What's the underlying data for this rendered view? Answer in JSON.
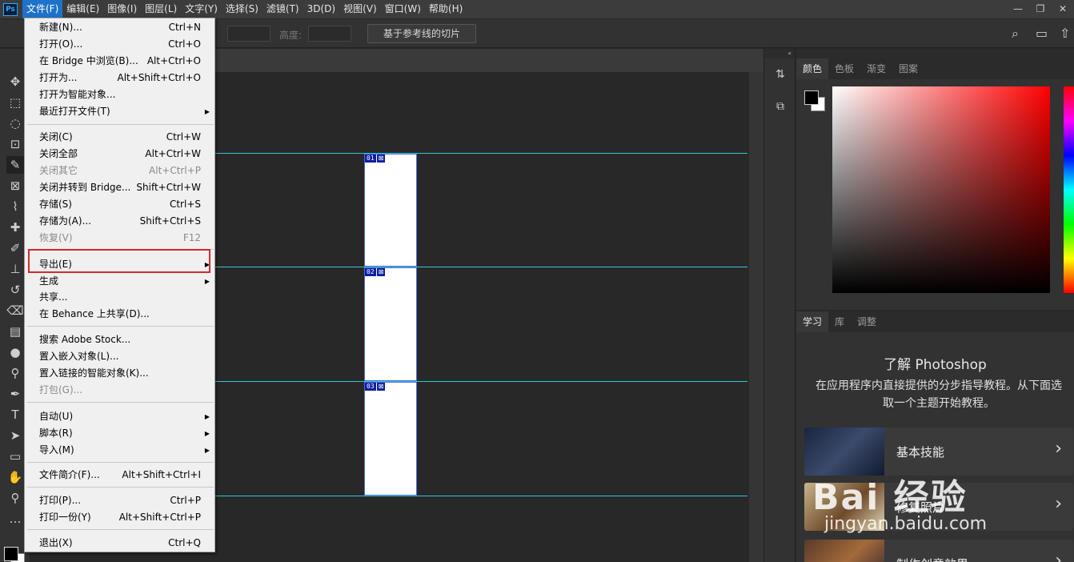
{
  "app": {
    "logo": "Ps"
  },
  "menubar": {
    "items": [
      "文件(F)",
      "编辑(E)",
      "图像(I)",
      "图层(L)",
      "文字(Y)",
      "选择(S)",
      "滤镜(T)",
      "3D(D)",
      "视图(V)",
      "窗口(W)",
      "帮助(H)"
    ],
    "window_controls": [
      "—",
      "❐",
      "✕"
    ]
  },
  "options_bar": {
    "height_label": "高度:",
    "slice_button": "基于参考线的切片"
  },
  "file_menu": {
    "items": [
      {
        "label": "新建(N)...",
        "shortcut": "Ctrl+N",
        "disabled": false,
        "submenu": false
      },
      {
        "label": "打开(O)...",
        "shortcut": "Ctrl+O",
        "disabled": false,
        "submenu": false
      },
      {
        "label": "在 Bridge 中浏览(B)...",
        "shortcut": "Alt+Ctrl+O",
        "disabled": false,
        "submenu": false
      },
      {
        "label": "打开为...",
        "shortcut": "Alt+Shift+Ctrl+O",
        "disabled": false,
        "submenu": false
      },
      {
        "label": "打开为智能对象...",
        "shortcut": "",
        "disabled": false,
        "submenu": false
      },
      {
        "label": "最近打开文件(T)",
        "shortcut": "",
        "disabled": false,
        "submenu": true
      },
      {
        "label": "关闭(C)",
        "shortcut": "Ctrl+W",
        "disabled": false,
        "submenu": false
      },
      {
        "label": "关闭全部",
        "shortcut": "Alt+Ctrl+W",
        "disabled": false,
        "submenu": false
      },
      {
        "label": "关闭其它",
        "shortcut": "Alt+Ctrl+P",
        "disabled": true,
        "submenu": false
      },
      {
        "label": "关闭并转到 Bridge...",
        "shortcut": "Shift+Ctrl+W",
        "disabled": false,
        "submenu": false
      },
      {
        "label": "存储(S)",
        "shortcut": "Ctrl+S",
        "disabled": false,
        "submenu": false
      },
      {
        "label": "存储为(A)...",
        "shortcut": "Shift+Ctrl+S",
        "disabled": false,
        "submenu": false
      },
      {
        "label": "恢复(V)",
        "shortcut": "F12",
        "disabled": true,
        "submenu": false
      },
      {
        "label": "导出(E)",
        "shortcut": "",
        "disabled": false,
        "submenu": true
      },
      {
        "label": "生成",
        "shortcut": "",
        "disabled": false,
        "submenu": true
      },
      {
        "label": "共享...",
        "shortcut": "",
        "disabled": false,
        "submenu": false
      },
      {
        "label": "在 Behance 上共享(D)...",
        "shortcut": "",
        "disabled": false,
        "submenu": false
      },
      {
        "label": "搜索 Adobe Stock...",
        "shortcut": "",
        "disabled": false,
        "submenu": false
      },
      {
        "label": "置入嵌入对象(L)...",
        "shortcut": "",
        "disabled": false,
        "submenu": false
      },
      {
        "label": "置入链接的智能对象(K)...",
        "shortcut": "",
        "disabled": false,
        "submenu": false
      },
      {
        "label": "打包(G)...",
        "shortcut": "",
        "disabled": true,
        "submenu": false
      },
      {
        "label": "自动(U)",
        "shortcut": "",
        "disabled": false,
        "submenu": true
      },
      {
        "label": "脚本(R)",
        "shortcut": "",
        "disabled": false,
        "submenu": true
      },
      {
        "label": "导入(M)",
        "shortcut": "",
        "disabled": false,
        "submenu": true
      },
      {
        "label": "文件简介(F)...",
        "shortcut": "Alt+Shift+Ctrl+I",
        "disabled": false,
        "submenu": false
      },
      {
        "label": "打印(P)...",
        "shortcut": "Ctrl+P",
        "disabled": false,
        "submenu": false
      },
      {
        "label": "打印一份(Y)",
        "shortcut": "Alt+Shift+Ctrl+P",
        "disabled": false,
        "submenu": false
      },
      {
        "label": "退出(X)",
        "shortcut": "Ctrl+Q",
        "disabled": false,
        "submenu": false
      }
    ]
  },
  "canvas": {
    "slices": [
      "01",
      "02",
      "03"
    ]
  },
  "color_panel": {
    "tabs": [
      "颜色",
      "色板",
      "渐变",
      "图案"
    ],
    "active_tab": "颜色"
  },
  "learn_panel": {
    "tabs": [
      "学习",
      "库",
      "调整"
    ],
    "title": "了解 Photoshop",
    "description": "在应用程序内直接提供的分步指导教程。从下面选取一个主题开始教程。",
    "cards": [
      "基本技能",
      "修复照片",
      "制作创意效果"
    ]
  },
  "watermark": {
    "brand": "Bai 经验",
    "url": "jingyan.baidu.com"
  },
  "colors": {
    "highlight_box": "#d42a2a",
    "guide": "#35c4dc",
    "slice_badge": "#0b1f9e",
    "active_menu": "#1f72c9"
  }
}
